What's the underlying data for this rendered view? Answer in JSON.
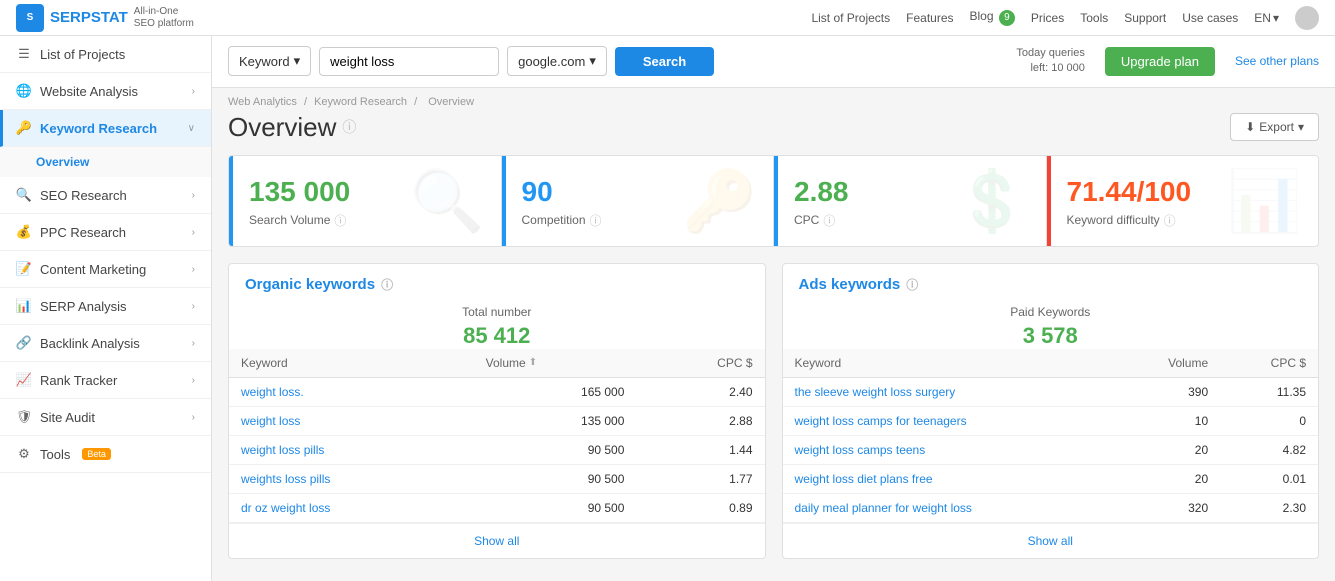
{
  "topnav": {
    "logo_text": "SERPSTAT",
    "logo_abbr": "S",
    "tagline_line1": "All-in-One",
    "tagline_line2": "SEO platform",
    "links": [
      "List of Projects",
      "Features",
      "Blog",
      "Prices",
      "Tools",
      "Support",
      "Use cases"
    ],
    "blog_count": "9",
    "lang": "EN"
  },
  "sidebar": {
    "items": [
      {
        "id": "list-of-projects",
        "label": "List of Projects",
        "icon": "☰",
        "has_sub": false
      },
      {
        "id": "website-analysis",
        "label": "Website Analysis",
        "icon": "🌐",
        "has_sub": true
      },
      {
        "id": "keyword-research",
        "label": "Keyword Research",
        "icon": "🔑",
        "has_sub": true,
        "expanded": true
      },
      {
        "id": "seo-research",
        "label": "SEO Research",
        "icon": "🔍",
        "has_sub": true
      },
      {
        "id": "ppc-research",
        "label": "PPC Research",
        "icon": "💰",
        "has_sub": true
      },
      {
        "id": "content-marketing",
        "label": "Content Marketing",
        "icon": "📝",
        "has_sub": true
      },
      {
        "id": "serp-analysis",
        "label": "SERP Analysis",
        "icon": "📊",
        "has_sub": true
      },
      {
        "id": "backlink-analysis",
        "label": "Backlink Analysis",
        "icon": "🔗",
        "has_sub": true
      },
      {
        "id": "rank-tracker",
        "label": "Rank Tracker",
        "icon": "📈",
        "has_sub": true
      },
      {
        "id": "site-audit",
        "label": "Site Audit",
        "icon": "🛡",
        "has_sub": true
      },
      {
        "id": "tools",
        "label": "Tools",
        "icon": "⚙",
        "has_sub": false,
        "beta": true
      }
    ],
    "sub_items": [
      "Overview"
    ]
  },
  "searchbar": {
    "type_label": "Keyword",
    "input_value": "weight loss",
    "engine_value": "google.com",
    "search_label": "Search",
    "queries_label": "Today queries",
    "queries_left_label": "left: 10 000",
    "upgrade_label": "Upgrade plan",
    "see_plans_label": "See other plans"
  },
  "breadcrumb": {
    "parts": [
      "Web Analytics",
      "Keyword Research",
      "Overview"
    ]
  },
  "page": {
    "title": "Overview",
    "export_label": "Export"
  },
  "metrics": [
    {
      "value": "135 000",
      "label": "Search Volume",
      "color": "green",
      "accent": "blue"
    },
    {
      "value": "90",
      "label": "Competition",
      "color": "blue",
      "accent": "blue"
    },
    {
      "value": "2.88",
      "label": "CPC",
      "color": "green",
      "accent": "blue"
    },
    {
      "value": "71.44/100",
      "label": "Keyword difficulty",
      "color": "orange",
      "accent": "red"
    }
  ],
  "organic_keywords": {
    "title": "Organic keywords",
    "total_label": "Total number",
    "total_value": "85 412",
    "columns": [
      "Keyword",
      "Volume",
      "CPC $"
    ],
    "rows": [
      {
        "keyword": "weight loss.",
        "volume": "165 000",
        "cpc": "2.40"
      },
      {
        "keyword": "weight loss",
        "volume": "135 000",
        "cpc": "2.88"
      },
      {
        "keyword": "weight loss pills",
        "volume": "90 500",
        "cpc": "1.44"
      },
      {
        "keyword": "weights loss pills",
        "volume": "90 500",
        "cpc": "1.77"
      },
      {
        "keyword": "dr oz weight loss",
        "volume": "90 500",
        "cpc": "0.89"
      }
    ],
    "show_all_label": "Show all"
  },
  "ads_keywords": {
    "title": "Ads keywords",
    "total_label": "Paid Keywords",
    "total_value": "3 578",
    "columns": [
      "Keyword",
      "Volume",
      "CPC $"
    ],
    "rows": [
      {
        "keyword": "the sleeve weight loss surgery",
        "volume": "390",
        "cpc": "11.35"
      },
      {
        "keyword": "weight loss camps for teenagers",
        "volume": "10",
        "cpc": "0"
      },
      {
        "keyword": "weight loss camps teens",
        "volume": "20",
        "cpc": "4.82"
      },
      {
        "keyword": "weight loss diet plans free",
        "volume": "20",
        "cpc": "0.01"
      },
      {
        "keyword": "daily meal planner for weight loss",
        "volume": "320",
        "cpc": "2.30"
      }
    ],
    "show_all_label": "Show all"
  }
}
